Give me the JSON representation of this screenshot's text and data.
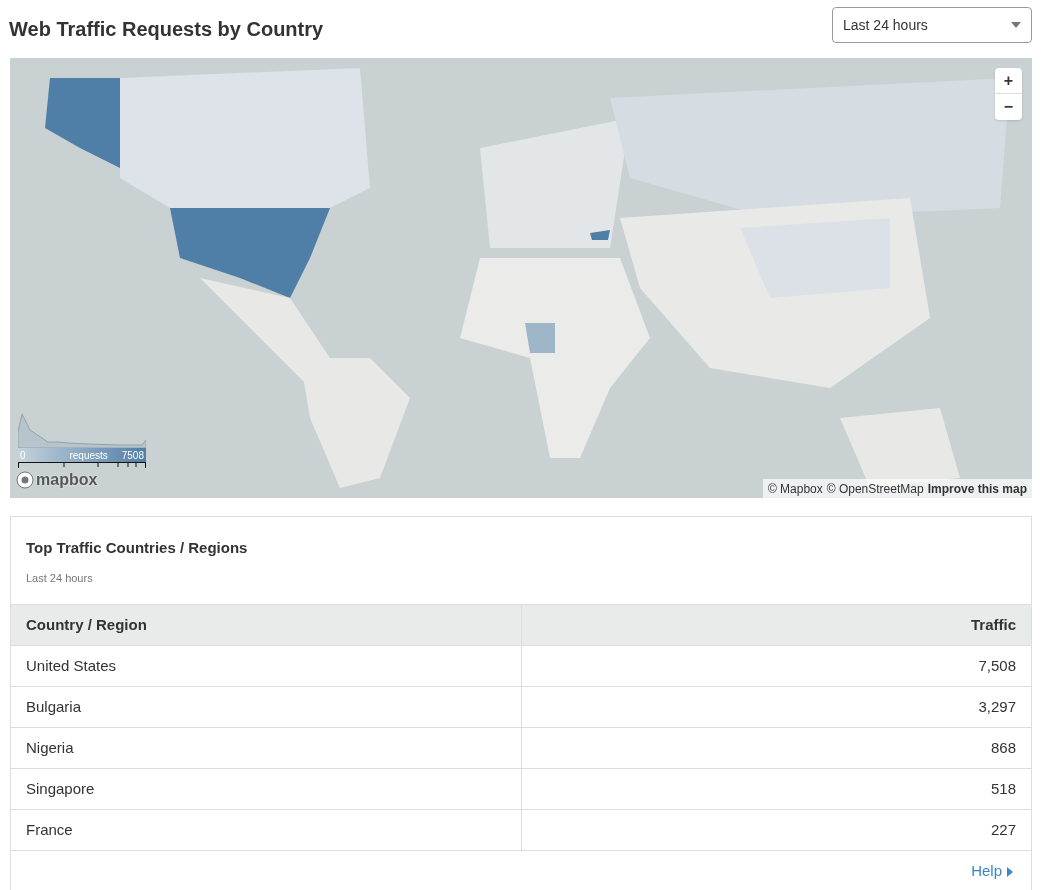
{
  "header": {
    "title": "Web Traffic Requests by Country",
    "range_select": {
      "value": "Last 24 hours"
    }
  },
  "map": {
    "kind": "picture",
    "zoom_in": "+",
    "zoom_out": "−",
    "legend": {
      "min": "0",
      "label": "requests",
      "max": "7508"
    },
    "logo": "mapbox",
    "attribution": [
      "© Mapbox",
      "© OpenStreetMap"
    ],
    "improve_link": "Improve this map"
  },
  "card": {
    "title": "Top Traffic Countries / Regions",
    "subtitle": "Last 24 hours",
    "columns": [
      "Country / Region",
      "Traffic"
    ],
    "rows": [
      [
        "United States",
        "7,508"
      ],
      [
        "Bulgaria",
        "3,297"
      ],
      [
        "Nigeria",
        "868"
      ],
      [
        "Singapore",
        "518"
      ],
      [
        "France",
        "227"
      ]
    ],
    "help_link": "Help"
  }
}
